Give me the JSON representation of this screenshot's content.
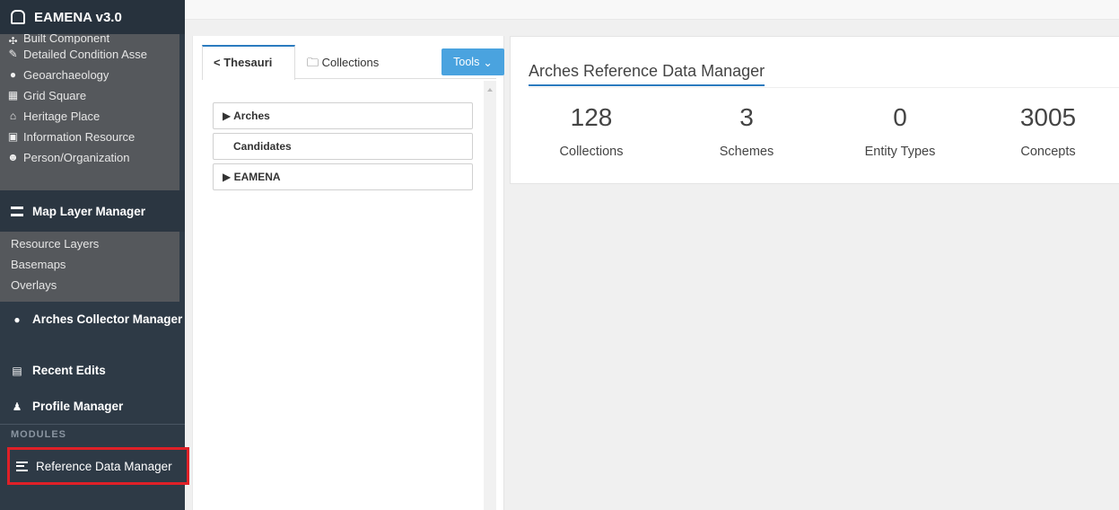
{
  "sidebar": {
    "brand": "EAMENA v3.0",
    "resources": [
      {
        "label": "Built Component"
      },
      {
        "label": "Detailed Condition Asse"
      },
      {
        "label": "Geoarchaeology"
      },
      {
        "label": "Grid Square"
      },
      {
        "label": "Heritage Place"
      },
      {
        "label": "Information Resource"
      },
      {
        "label": "Person/Organization"
      }
    ],
    "map_layer_manager": "Map Layer Manager",
    "map_layer_items": [
      {
        "label": "Resource Layers"
      },
      {
        "label": "Basemaps"
      },
      {
        "label": "Overlays"
      }
    ],
    "arches_collector": "Arches Collector Manager",
    "recent_edits": "Recent Edits",
    "profile_manager": "Profile Manager",
    "modules_heading": "MODULES",
    "reference_data_manager": "Reference Data Manager"
  },
  "left_panel": {
    "tab_thesauri": "Thesauri",
    "tab_collections": "Collections",
    "tools_label": "Tools",
    "tree": [
      {
        "label": "Arches",
        "expandable": true
      },
      {
        "label": "Candidates",
        "expandable": false
      },
      {
        "label": "EAMENA",
        "expandable": true
      }
    ]
  },
  "right_panel": {
    "title": "Arches Reference Data Manager",
    "stats": [
      {
        "value": "128",
        "label": "Collections"
      },
      {
        "value": "3",
        "label": "Schemes"
      },
      {
        "value": "0",
        "label": "Entity Types"
      },
      {
        "value": "3005",
        "label": "Concepts"
      }
    ]
  },
  "colors": {
    "sidebar_bg": "#2e3a46",
    "accent": "#2b7bbf",
    "tools_btn": "#4aa3df",
    "highlight": "#e02027"
  }
}
